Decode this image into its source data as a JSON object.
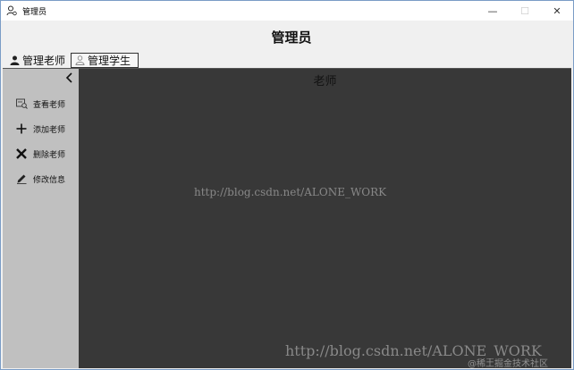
{
  "window": {
    "title": "管理员",
    "controls": {
      "minimize": "—",
      "maximize": "☐",
      "close": "✕"
    }
  },
  "header": {
    "title": "管理员"
  },
  "tabs": [
    {
      "label": "管理老师",
      "icon": "user-icon",
      "active": true
    },
    {
      "label": "管理学生",
      "icon": "user-icon",
      "active": false
    }
  ],
  "sidebar": {
    "collapse_icon": "chevron-left-icon",
    "items": [
      {
        "label": "查看老师",
        "icon": "view-icon"
      },
      {
        "label": "添加老师",
        "icon": "plus-icon"
      },
      {
        "label": "删除老师",
        "icon": "close-icon"
      },
      {
        "label": "修改信息",
        "icon": "edit-icon"
      }
    ]
  },
  "content": {
    "title": "老师"
  },
  "watermarks": {
    "center": "http://blog.csdn.net/ALONE_WORK",
    "bottom": "http://blog.csdn.net/ALONE_WORK",
    "corner": "@稀土掘金技术社区"
  },
  "colors": {
    "sidebar_bg": "#c0c0c0",
    "content_bg": "#383838",
    "window_bg": "#f0f0f0"
  }
}
